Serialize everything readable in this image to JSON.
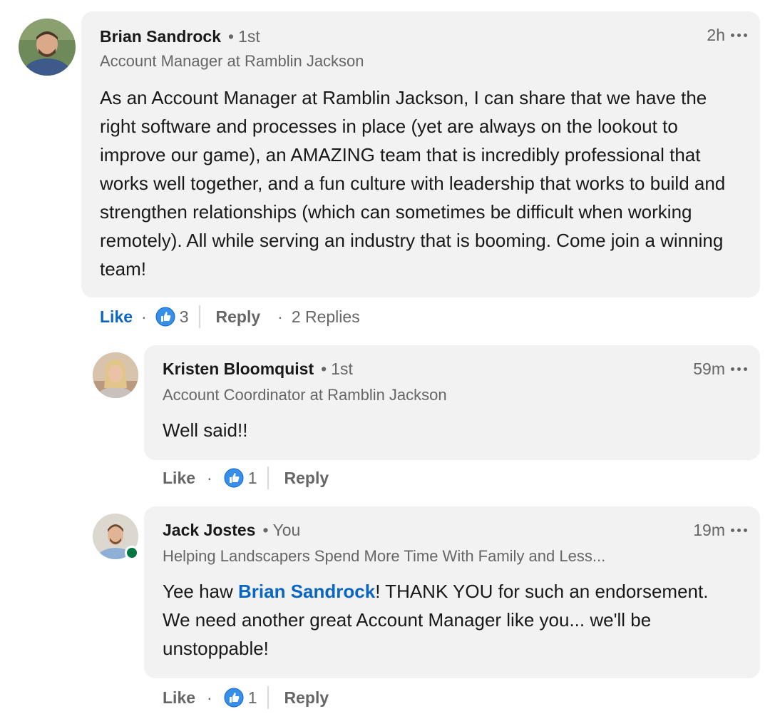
{
  "comments": [
    {
      "author": "Brian Sandrock",
      "degree": "1st",
      "headline": "Account Manager at Ramblin Jackson",
      "time": "2h",
      "text": "As an Account Manager at Ramblin Jackson, I can share that we have the right software and processes in place (yet are always on the lookout to improve our game), an AMAZING team that is incredibly professional that works well together, and a fun culture with leadership that works to build and strengthen relationships (which can sometimes be difficult when working remotely). All while serving an industry that is booming. Come join a winning team!",
      "like_label": "Like",
      "like_count": "3",
      "reply_label": "Reply",
      "replies_label": "2 Replies"
    },
    {
      "author": "Kristen Bloomquist",
      "degree": "1st",
      "headline": "Account Coordinator at Ramblin Jackson",
      "time": "59m",
      "text": "Well said!!",
      "like_label": "Like",
      "like_count": "1",
      "reply_label": "Reply"
    },
    {
      "author": "Jack Jostes",
      "degree": "You",
      "headline": "Helping Landscapers Spend More Time With Family and Less...",
      "time": "19m",
      "text_prefix": "Yee haw ",
      "mention": "Brian Sandrock",
      "text_suffix": "! THANK YOU for such an endorsement. We need another great Account Manager like you... we'll be unstoppable!",
      "like_label": "Like",
      "like_count": "1",
      "reply_label": "Reply"
    }
  ],
  "separator_dot": "•",
  "action_dot": "·",
  "colors": {
    "accent": "#0a66c2",
    "bubble": "#f2f2f2",
    "muted": "#666666",
    "online": "#057642"
  }
}
